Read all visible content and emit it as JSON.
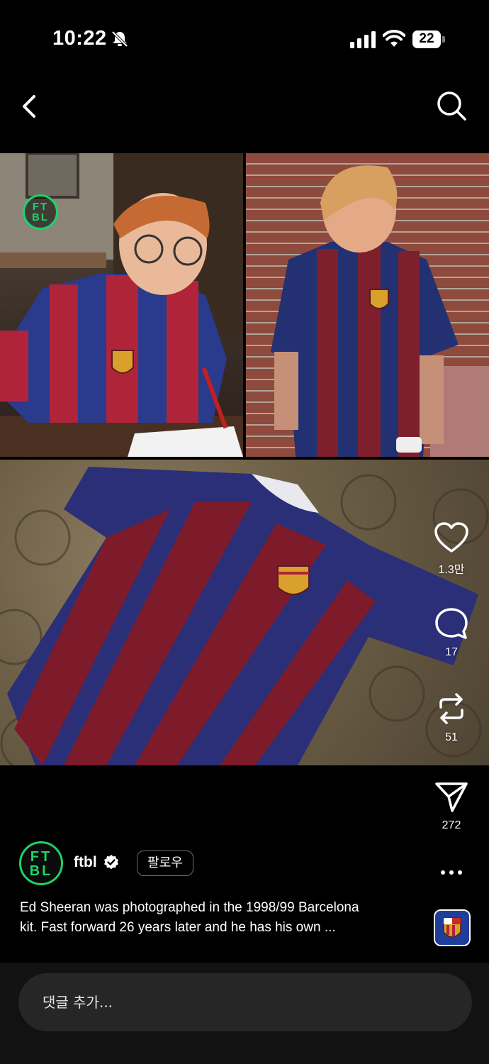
{
  "status_bar": {
    "time": "10:22",
    "battery_level": "22"
  },
  "nav": {
    "back_icon": "chevron-left-icon",
    "search_icon": "search-icon"
  },
  "media": {
    "badge_line1": "FT",
    "badge_line2": "BL"
  },
  "actions": {
    "like_count": "1.3만",
    "comment_count": "17",
    "repost_count": "51",
    "share_count": "272"
  },
  "post": {
    "author_avatar_line1": "FT",
    "author_avatar_line2": "BL",
    "author": "ftbl",
    "follow_label": "팔로우",
    "caption_line1": "Ed Sheeran was photographed in the 1998/99 Barcelona",
    "caption_line2": "kit. Fast forward 26 years later and he has his own ..."
  },
  "comment": {
    "placeholder": "댓글 추가..."
  },
  "colors": {
    "accent_green": "#1bd36a",
    "barca_blue": "#2a3a8c",
    "barca_red": "#8c1f2e"
  }
}
